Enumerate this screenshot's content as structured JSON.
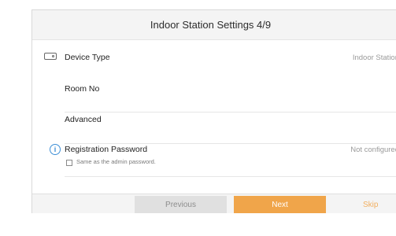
{
  "header": {
    "title": "Indoor Station Settings 4/9"
  },
  "rows": {
    "device_type": {
      "label": "Device Type",
      "value": "Indoor Station",
      "icon": "device-icon"
    },
    "room_no": {
      "label": "Room No"
    },
    "advanced": {
      "label": "Advanced"
    },
    "registration": {
      "label": "Registration Password",
      "value": "Not configured",
      "icon": "info-icon",
      "checkbox_label": "Same as the admin password.",
      "checkbox_checked": false
    }
  },
  "footer": {
    "previous": "Previous",
    "next": "Next",
    "skip": "Skip"
  },
  "colors": {
    "accent": "#f0a54a",
    "info": "#3c8ed6",
    "header_bg": "#f4f4f4"
  }
}
